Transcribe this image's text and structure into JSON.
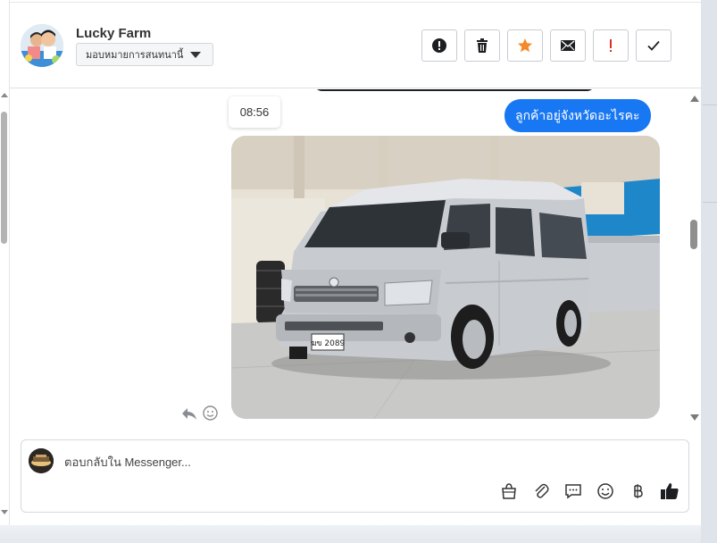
{
  "header": {
    "contact_name": "Lucky Farm",
    "assign_label": "มอบหมายการสนทนานี้",
    "actions": [
      {
        "name": "report-button",
        "icon": "alert-circle-icon"
      },
      {
        "name": "delete-button",
        "icon": "trash-icon"
      },
      {
        "name": "star-button",
        "icon": "star-icon",
        "color": "#f5892a"
      },
      {
        "name": "mark-unread-button",
        "icon": "envelope-icon"
      },
      {
        "name": "important-button",
        "icon": "exclamation-icon",
        "color": "#d93025"
      },
      {
        "name": "done-button",
        "icon": "checkmark-icon"
      }
    ]
  },
  "conversation": {
    "timestamp": "08:56",
    "message_text": "ลูกค้าอยู่จังหวัดอะไรคะ",
    "bubble_color": "#1877f2",
    "plate_text": "ฆข 2089"
  },
  "composer": {
    "placeholder": "ตอบกลับใน Messenger...",
    "tools": [
      "shopping-bag-icon",
      "paperclip-icon",
      "chat-bubble-icon",
      "smiley-icon",
      "baht-icon",
      "thumbs-up-icon"
    ]
  }
}
